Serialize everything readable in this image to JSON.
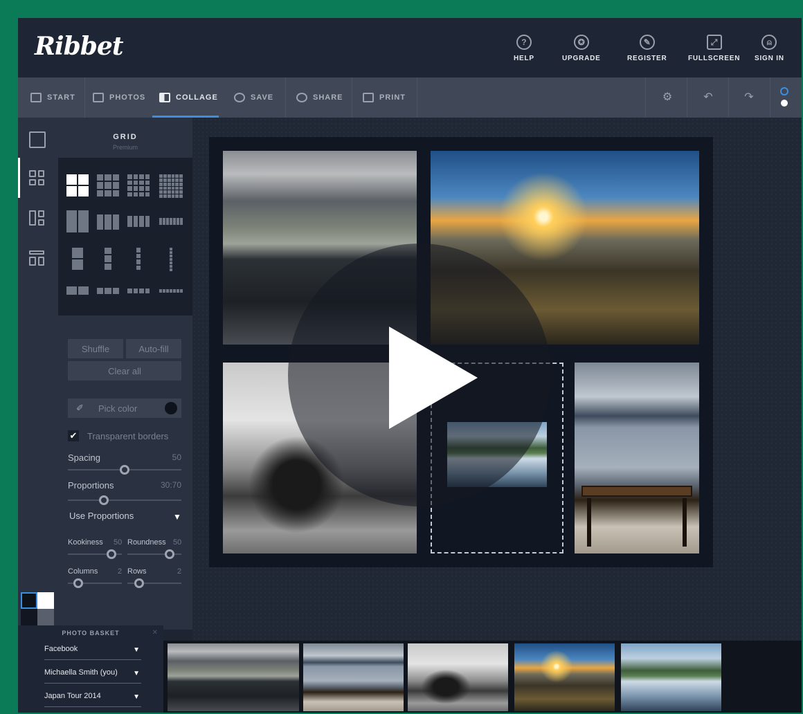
{
  "app": {
    "logo": "Ribbet"
  },
  "header": {
    "nav": [
      {
        "label": "HELP",
        "icon": "help-icon",
        "glyph": "?"
      },
      {
        "label": "UPGRADE",
        "icon": "upgrade-badge-icon",
        "glyph": "✪"
      },
      {
        "label": "REGISTER",
        "icon": "register-user-icon",
        "glyph": "✎"
      },
      {
        "label": "FULLSCREEN",
        "icon": "fullscreen-icon",
        "glyph": "⤢"
      },
      {
        "label": "SIGN IN",
        "icon": "sign-in-user-icon",
        "glyph": "⍝"
      }
    ]
  },
  "toolbar": {
    "tabs": [
      {
        "label": "START",
        "icon": "home-icon"
      },
      {
        "label": "PHOTOS",
        "icon": "photos-icon"
      },
      {
        "label": "COLLAGE",
        "icon": "collage-icon",
        "active": true
      },
      {
        "label": "SAVE",
        "icon": "save-check-icon"
      },
      {
        "label": "SHARE",
        "icon": "share-icon"
      },
      {
        "label": "PRINT",
        "icon": "print-icon"
      }
    ],
    "settings_glyph": "⚙",
    "undo_glyph": "↶",
    "redo_glyph": "↷"
  },
  "panel": {
    "title": "GRID",
    "subtitle": "Premium",
    "shuffle": "Shuffle",
    "autofill": "Auto-fill",
    "clear_all": "Clear all",
    "pick_color": "Pick color",
    "eyedropper_glyph": "✐",
    "transparent_borders": "Transparent borders",
    "check_glyph": "✔",
    "spacing_label": "Spacing",
    "spacing_value": "50",
    "spacing_level": 0.5,
    "proportions_label": "Proportions",
    "proportions_value": "30:70",
    "proportions_level": 0.3,
    "use_proportions": "Use Proportions",
    "dropdown_glyph": "▼",
    "kookiness_label": "Kookiness",
    "kookiness_value": "50",
    "roundness_label": "Roundness",
    "roundness_value": "50",
    "columns_label": "Columns",
    "columns_value": "2",
    "rows_label": "Rows",
    "rows_value": "2"
  },
  "basket": {
    "title": "PHOTO BASKET",
    "close_glyph": "✕",
    "source": "Facebook",
    "account": "Michaella Smith (you)",
    "album": "Japan Tour 2014",
    "arrow": "▼"
  },
  "colors": {
    "accent": "#3b8fe0",
    "background": "#1d2432",
    "toolbar": "#404857",
    "border_frame": "#0b7a57"
  }
}
